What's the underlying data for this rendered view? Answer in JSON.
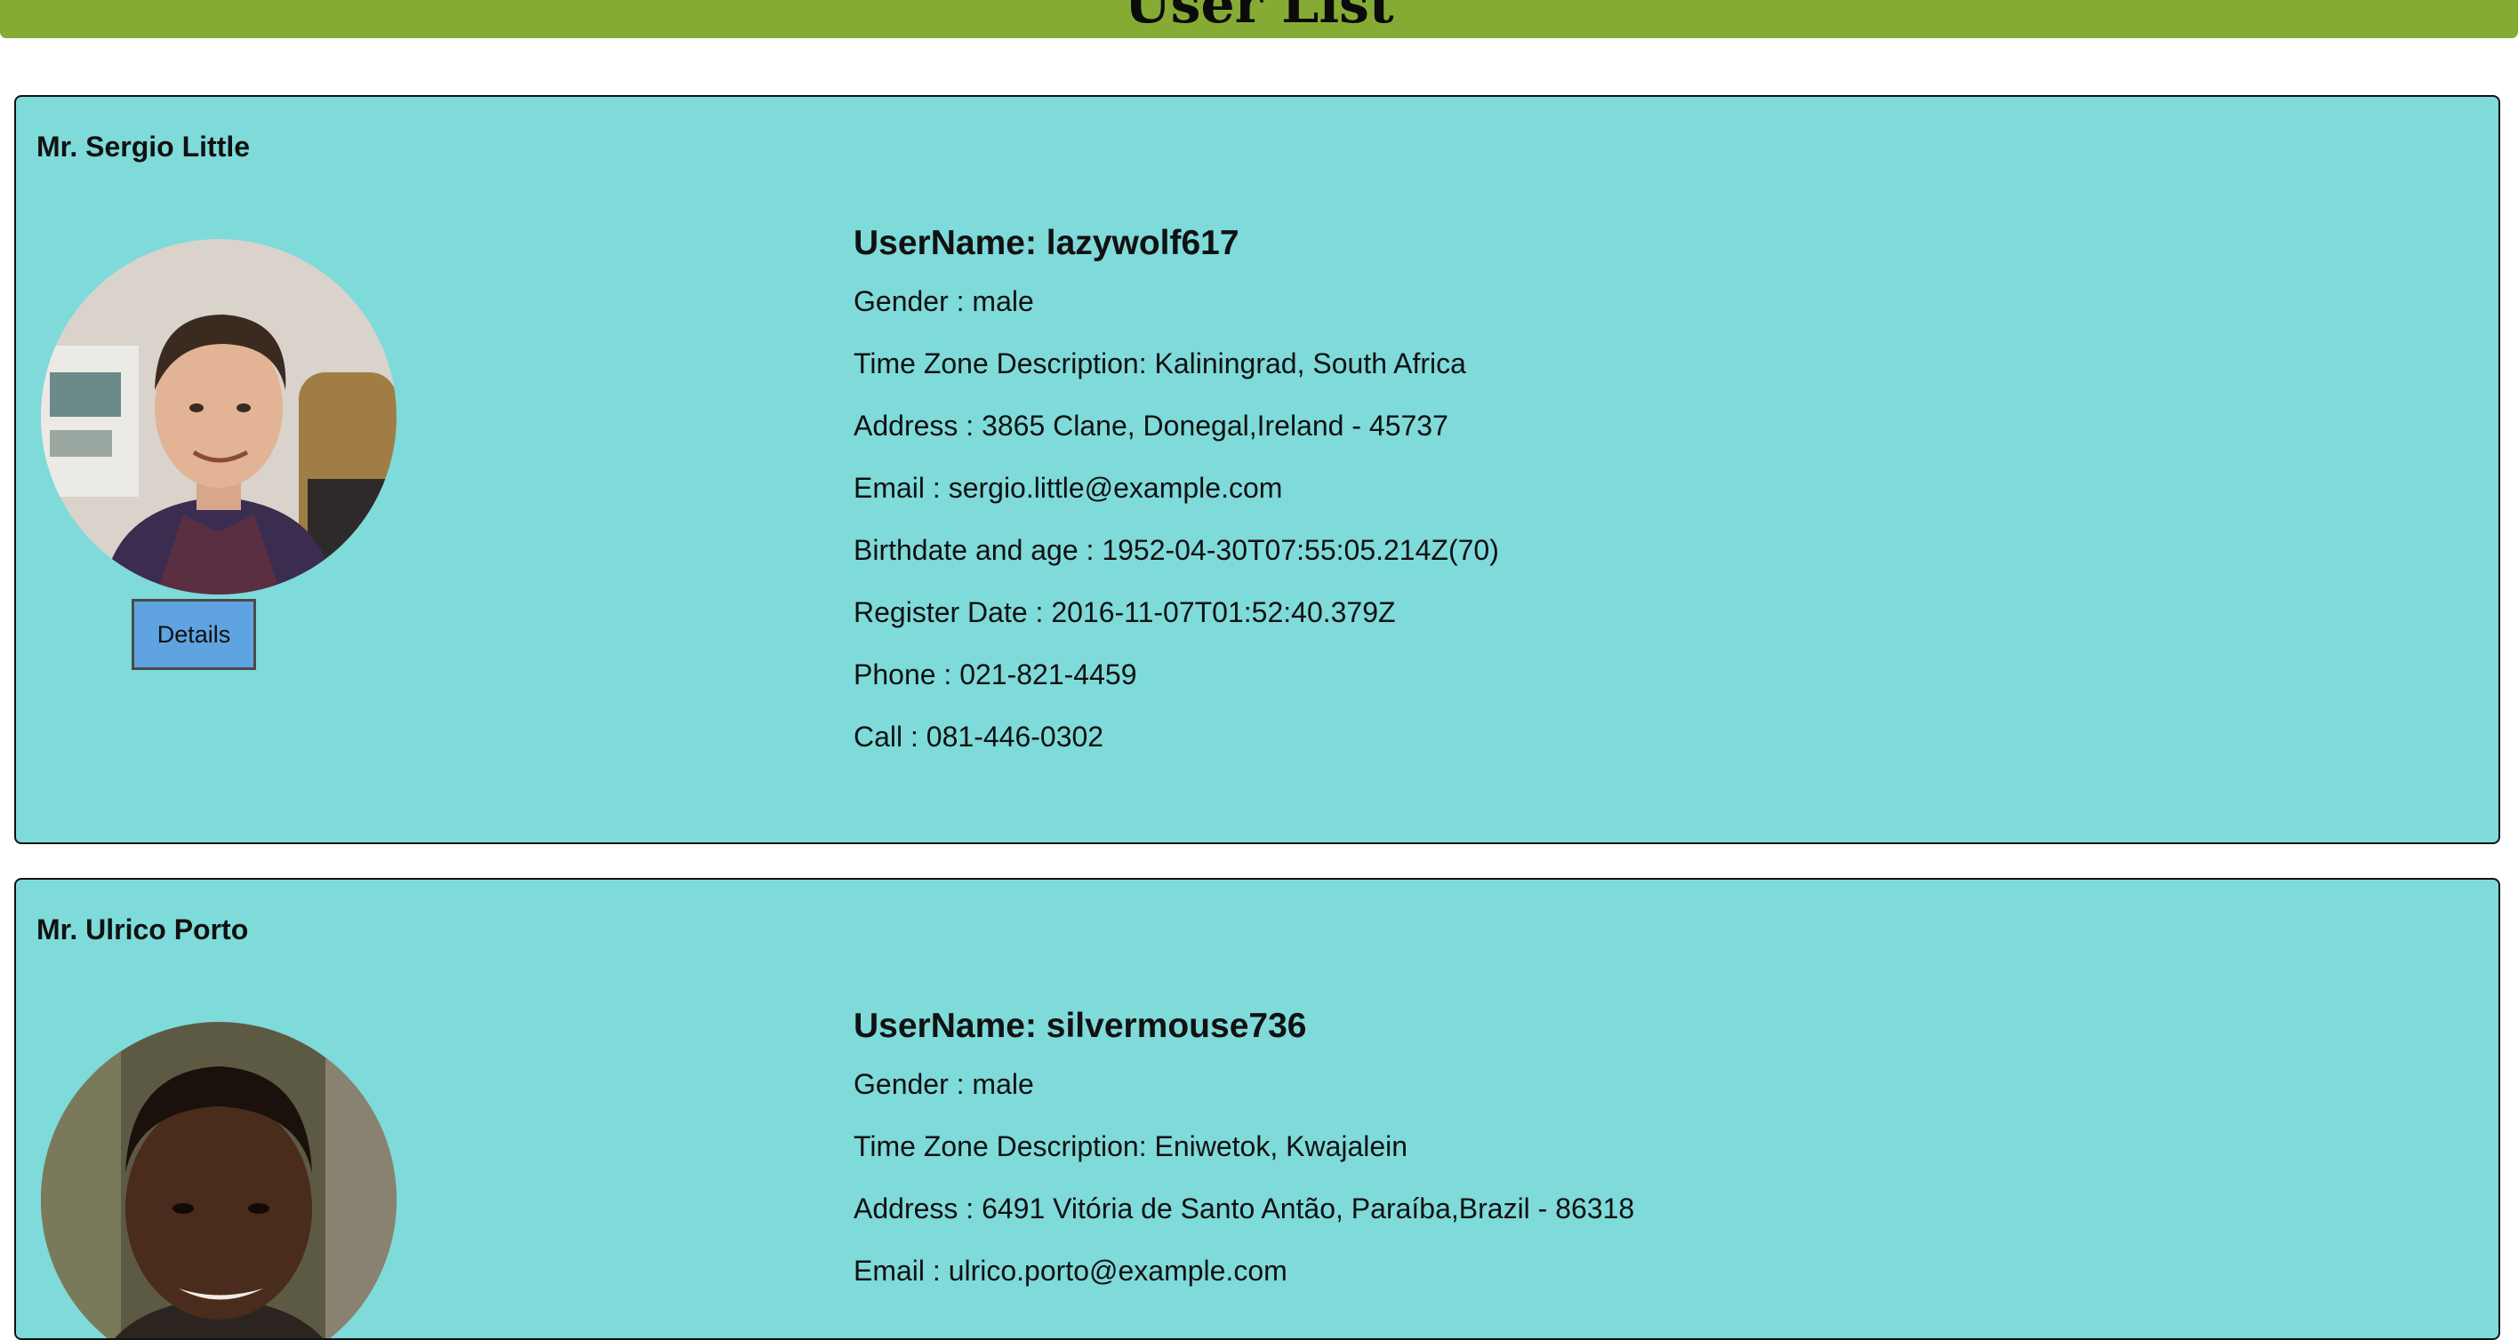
{
  "header": {
    "title": "User List"
  },
  "users": [
    {
      "full_name": "Mr. Sergio Little",
      "details_label": "Details",
      "username": "UserName: lazywolf617",
      "gender": "Gender : male",
      "timezone": "Time Zone Description: Kaliningrad, South Africa",
      "address": "Address : 3865 Clane, Donegal,Ireland - 45737",
      "email": "Email : sergio.little@example.com",
      "birthdate": "Birthdate and age : 1952-04-30T07:55:05.214Z(70)",
      "register_date": "Register Date : 2016-11-07T01:52:40.379Z",
      "phone": "Phone : 021-821-4459",
      "call": "Call : 081-446-0302"
    },
    {
      "full_name": "Mr. Ulrico Porto",
      "username": "UserName: silvermouse736",
      "gender": "Gender : male",
      "timezone": "Time Zone Description: Eniwetok, Kwajalein",
      "address": "Address : 6491 Vitória de Santo Antão, Paraíba,Brazil - 86318",
      "email": "Email : ulrico.porto@example.com"
    }
  ]
}
